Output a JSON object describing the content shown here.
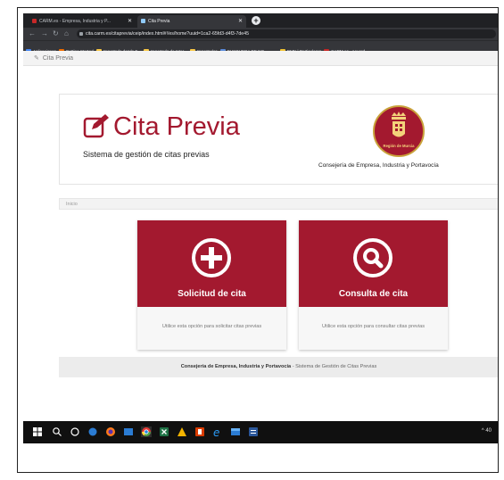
{
  "browser": {
    "tabs": [
      {
        "label": "CARM.es - Empresa, Industria y P...",
        "favicon_color": "#c62828"
      },
      {
        "label": "Cita Previa",
        "favicon_color": "#90caf9"
      }
    ],
    "url": "cita.carm.es/citaprevia/ceip/index.html#!/es/home?uuid=1ca2-65fd3-d4f3-7de45",
    "bookmarks": [
      {
        "label": "Aplicaciones",
        "color": "#4285f4"
      },
      {
        "label": "Getting Started",
        "color": "#ef6c00"
      },
      {
        "label": "Importado desde F...",
        "color": "#f9c846"
      },
      {
        "label": "Importado de Inter...",
        "color": "#f9c846"
      },
      {
        "label": "Importados",
        "color": "#f9c846"
      },
      {
        "label": "BUSQUEDA DE NO...",
        "color": "#5b8bd9"
      },
      {
        "label": "",
        "color": "#9aa0a6"
      },
      {
        "label": "BMN | Particulares",
        "color": "#f1c232"
      },
      {
        "label": "CARM.es - Acuerd",
        "color": "#c62828"
      }
    ]
  },
  "app": {
    "bar_title": "Cita Previa",
    "title": "Cita Previa",
    "subtitle": "Sistema de gestión de citas previas",
    "seal_label": "Región de Murcia",
    "consejeria": "Consejería de Empresa, Industria y Portavocía",
    "breadcrumb": "Inicio"
  },
  "cards": [
    {
      "label": "Solicitud de cita",
      "description": "Utilice esta opción para solicitar citas previas",
      "icon": "plus-circle-icon"
    },
    {
      "label": "Consulta de cita",
      "description": "Utilice esta opción para consultar citas previas",
      "icon": "search-circle-icon"
    }
  ],
  "footer": {
    "strong": "Consejería de Empresa, Industria y Portavocía",
    "rest": " - Sistema de Gestión de Citas Previas"
  },
  "taskbar": {
    "tray_text": "^ 40"
  },
  "colors": {
    "brand": "#a3192f",
    "chrome_dark": "#202124",
    "chrome_mid": "#35363a"
  }
}
